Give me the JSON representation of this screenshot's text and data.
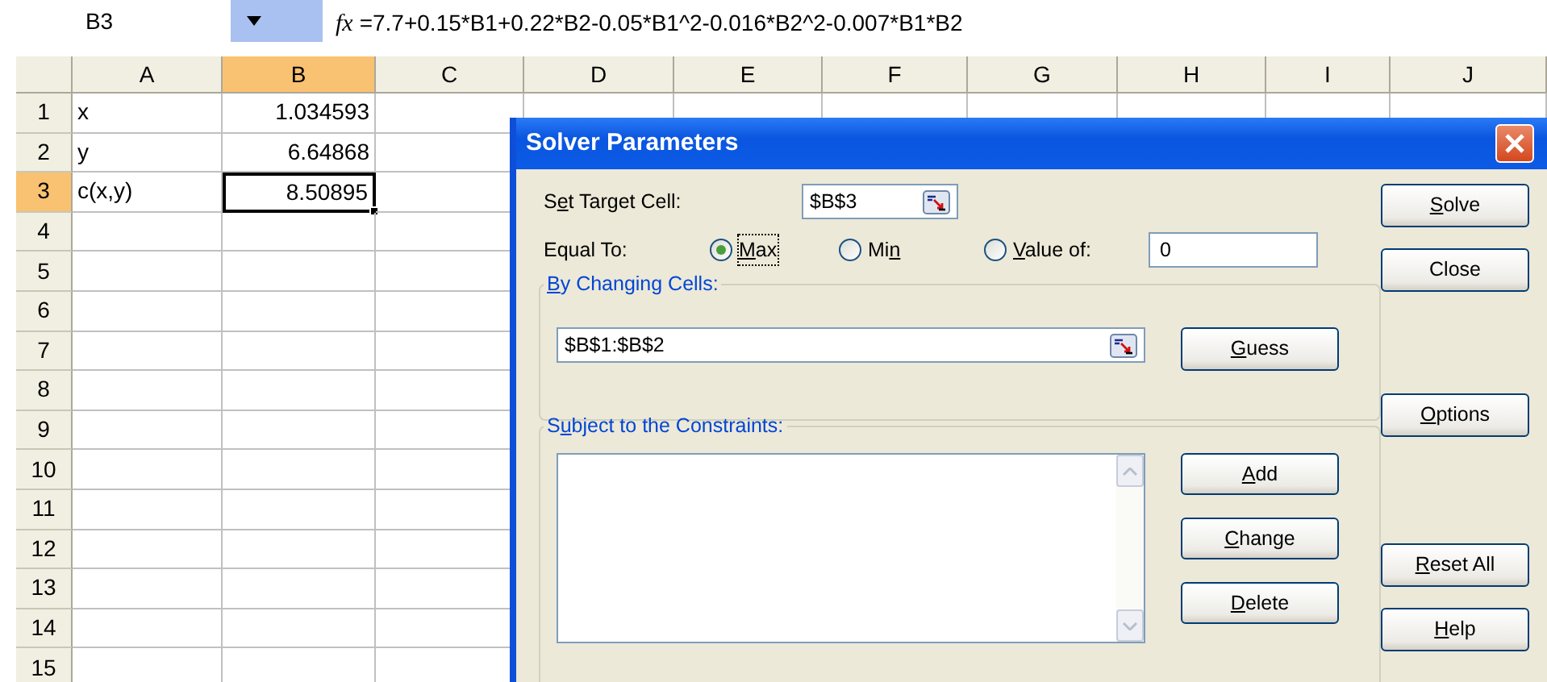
{
  "formula_bar": {
    "name_box": "B3",
    "function_label": "fx",
    "formula": "=7.7+0.15*B1+0.22*B2-0.05*B1^2-0.016*B2^2-0.007*B1*B2"
  },
  "sheet": {
    "columns": [
      {
        "label": "A",
        "selected": false
      },
      {
        "label": "B",
        "selected": true
      },
      {
        "label": "C",
        "selected": false
      },
      {
        "label": "D",
        "selected": false
      },
      {
        "label": "E",
        "selected": false
      },
      {
        "label": "F",
        "selected": false
      },
      {
        "label": "G",
        "selected": false
      },
      {
        "label": "H",
        "selected": false
      },
      {
        "label": "I",
        "selected": false
      },
      {
        "label": "J",
        "selected": false
      }
    ],
    "rows": [
      {
        "label": "1",
        "selected": false,
        "cells": [
          {
            "kind": "text",
            "value": "x",
            "selected": false
          },
          {
            "kind": "number",
            "value": "1.034593",
            "selected": false
          }
        ]
      },
      {
        "label": "2",
        "selected": false,
        "cells": [
          {
            "kind": "text",
            "value": "y",
            "selected": false
          },
          {
            "kind": "number",
            "value": "6.64868",
            "selected": false
          }
        ]
      },
      {
        "label": "3",
        "selected": true,
        "cells": [
          {
            "kind": "text",
            "value": "c(x,y)",
            "selected": false
          },
          {
            "kind": "number",
            "value": "8.50895",
            "selected": true
          }
        ]
      },
      {
        "label": "4",
        "selected": false
      },
      {
        "label": "5",
        "selected": false
      },
      {
        "label": "6",
        "selected": false
      },
      {
        "label": "7",
        "selected": false
      },
      {
        "label": "8",
        "selected": false
      },
      {
        "label": "9",
        "selected": false
      },
      {
        "label": "10",
        "selected": false
      },
      {
        "label": "11",
        "selected": false
      },
      {
        "label": "12",
        "selected": false
      },
      {
        "label": "13",
        "selected": false
      },
      {
        "label": "14",
        "selected": false
      },
      {
        "label": "15",
        "selected": false
      }
    ]
  },
  "dialog": {
    "title": "Solver Parameters",
    "target_cell": {
      "label": {
        "before": "S",
        "key": "e",
        "after": "t Target Cell:"
      },
      "value": "$B$3"
    },
    "equal_to": {
      "label": "Equal To:",
      "options": [
        {
          "label": {
            "key": "M",
            "after": "ax"
          },
          "selected": true,
          "focused": true
        },
        {
          "label": {
            "before": "Mi",
            "key": "n"
          },
          "selected": false,
          "focused": false
        },
        {
          "label": {
            "key": "V",
            "after": "alue of:"
          },
          "selected": false,
          "focused": false
        }
      ],
      "value": "0"
    },
    "changing_cells": {
      "legend": {
        "key": "B",
        "after": "y Changing Cells:"
      },
      "value": "$B$1:$B$2",
      "button": {
        "key": "G",
        "after": "uess"
      }
    },
    "constraints": {
      "legend": {
        "before": "S",
        "key": "u",
        "after": "bject to the Constraints:"
      },
      "buttons": [
        {
          "key": "A",
          "after": "dd"
        },
        {
          "key": "C",
          "after": "hange"
        },
        {
          "key": "D",
          "after": "elete"
        }
      ]
    },
    "side_buttons": [
      {
        "label": {
          "key": "S",
          "after": "olve"
        }
      },
      {
        "label": {
          "before": "Close"
        }
      },
      {
        "label": {
          "key": "O",
          "after": "ptions"
        }
      },
      {
        "label": {
          "key": "R",
          "after": "eset All"
        }
      },
      {
        "label": {
          "key": "H",
          "after": "elp"
        }
      }
    ]
  }
}
